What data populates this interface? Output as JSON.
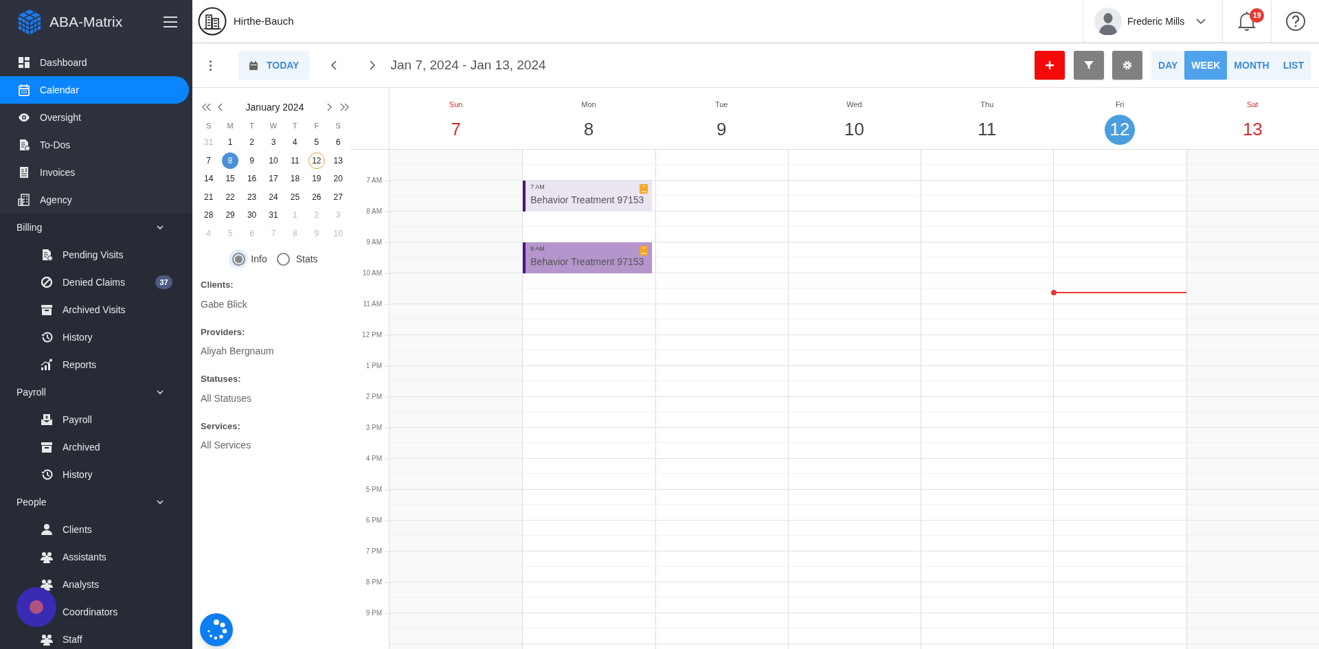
{
  "sidebar": {
    "brand": "ABA-Matrix",
    "items": [
      {
        "label": "Dashboard",
        "selected": false
      },
      {
        "label": "Calendar",
        "selected": true
      },
      {
        "label": "Oversight",
        "selected": false
      },
      {
        "label": "To-Dos",
        "selected": false
      },
      {
        "label": "Invoices",
        "selected": false
      },
      {
        "label": "Agency",
        "selected": false
      }
    ],
    "sections": [
      {
        "label": "Billing",
        "expanded": true,
        "items": [
          {
            "label": "Pending Visits",
            "selected": false
          },
          {
            "label": "Denied Claims",
            "selected": false,
            "badge": "37"
          },
          {
            "label": "Archived Visits",
            "selected": false
          },
          {
            "label": "History",
            "selected": false
          },
          {
            "label": "Reports",
            "selected": false
          }
        ]
      },
      {
        "label": "Payroll",
        "expanded": true,
        "items": [
          {
            "label": "Payroll",
            "selected": false
          },
          {
            "label": "Archived",
            "selected": false
          },
          {
            "label": "History",
            "selected": false
          }
        ]
      },
      {
        "label": "People",
        "expanded": true,
        "items": [
          {
            "label": "Clients",
            "selected": false
          },
          {
            "label": "Assistants",
            "selected": false
          },
          {
            "label": "Analysts",
            "selected": false
          },
          {
            "label": "Coordinators",
            "selected": false
          },
          {
            "label": "Staff",
            "selected": false
          }
        ]
      }
    ]
  },
  "header": {
    "company": "Hirthe-Bauch",
    "user": "Frederic Mills",
    "notifications": "19"
  },
  "toolbar": {
    "today": "TODAY",
    "range": "Jan 7, 2024 - Jan 13, 2024",
    "views": [
      {
        "label": "DAY",
        "selected": false
      },
      {
        "label": "WEEK",
        "selected": true
      },
      {
        "label": "MONTH",
        "selected": false
      },
      {
        "label": "LIST",
        "selected": false
      }
    ]
  },
  "mini_calendar": {
    "title": "January 2024",
    "weekdays": [
      "S",
      "M",
      "T",
      "W",
      "T",
      "F",
      "S"
    ],
    "weeks": [
      [
        {
          "label": "31",
          "muted": true,
          "selected": false,
          "today": false
        },
        {
          "label": "1",
          "muted": false,
          "selected": false,
          "today": false
        },
        {
          "label": "2",
          "muted": false,
          "selected": false,
          "today": false
        },
        {
          "label": "3",
          "muted": false,
          "selected": false,
          "today": false
        },
        {
          "label": "4",
          "muted": false,
          "selected": false,
          "today": false
        },
        {
          "label": "5",
          "muted": false,
          "selected": false,
          "today": false
        },
        {
          "label": "6",
          "muted": false,
          "selected": false,
          "today": false
        }
      ],
      [
        {
          "label": "7",
          "muted": false,
          "selected": false,
          "today": false
        },
        {
          "label": "8",
          "muted": false,
          "selected": true,
          "today": false
        },
        {
          "label": "9",
          "muted": false,
          "selected": false,
          "today": false
        },
        {
          "label": "10",
          "muted": false,
          "selected": false,
          "today": false
        },
        {
          "label": "11",
          "muted": false,
          "selected": false,
          "today": false
        },
        {
          "label": "12",
          "muted": false,
          "selected": false,
          "today": true
        },
        {
          "label": "13",
          "muted": false,
          "selected": false,
          "today": false
        }
      ],
      [
        {
          "label": "14",
          "muted": false,
          "selected": false,
          "today": false
        },
        {
          "label": "15",
          "muted": false,
          "selected": false,
          "today": false
        },
        {
          "label": "16",
          "muted": false,
          "selected": false,
          "today": false
        },
        {
          "label": "17",
          "muted": false,
          "selected": false,
          "today": false
        },
        {
          "label": "18",
          "muted": false,
          "selected": false,
          "today": false
        },
        {
          "label": "19",
          "muted": false,
          "selected": false,
          "today": false
        },
        {
          "label": "20",
          "muted": false,
          "selected": false,
          "today": false
        }
      ],
      [
        {
          "label": "21",
          "muted": false,
          "selected": false,
          "today": false
        },
        {
          "label": "22",
          "muted": false,
          "selected": false,
          "today": false
        },
        {
          "label": "23",
          "muted": false,
          "selected": false,
          "today": false
        },
        {
          "label": "24",
          "muted": false,
          "selected": false,
          "today": false
        },
        {
          "label": "25",
          "muted": false,
          "selected": false,
          "today": false
        },
        {
          "label": "26",
          "muted": false,
          "selected": false,
          "today": false
        },
        {
          "label": "27",
          "muted": false,
          "selected": false,
          "today": false
        }
      ],
      [
        {
          "label": "28",
          "muted": false,
          "selected": false,
          "today": false
        },
        {
          "label": "29",
          "muted": false,
          "selected": false,
          "today": false
        },
        {
          "label": "30",
          "muted": false,
          "selected": false,
          "today": false
        },
        {
          "label": "31",
          "muted": false,
          "selected": false,
          "today": false
        },
        {
          "label": "1",
          "muted": true,
          "selected": false,
          "today": false
        },
        {
          "label": "2",
          "muted": true,
          "selected": false,
          "today": false
        },
        {
          "label": "3",
          "muted": true,
          "selected": false,
          "today": false
        }
      ],
      [
        {
          "label": "4",
          "muted": true,
          "selected": false,
          "today": false
        },
        {
          "label": "5",
          "muted": true,
          "selected": false,
          "today": false
        },
        {
          "label": "6",
          "muted": true,
          "selected": false,
          "today": false
        },
        {
          "label": "7",
          "muted": true,
          "selected": false,
          "today": false
        },
        {
          "label": "8",
          "muted": true,
          "selected": false,
          "today": false
        },
        {
          "label": "9",
          "muted": true,
          "selected": false,
          "today": false
        },
        {
          "label": "10",
          "muted": true,
          "selected": false,
          "today": false
        }
      ]
    ]
  },
  "view_options": [
    {
      "label": "Info",
      "selected": true
    },
    {
      "label": "Stats",
      "selected": false
    }
  ],
  "filters": [
    {
      "label": "Clients:",
      "value": "Gabe Blick"
    },
    {
      "label": "Providers:",
      "value": "Aliyah Bergnaum"
    },
    {
      "label": "Statuses:",
      "value": "All Statuses"
    },
    {
      "label": "Services:",
      "value": "All Services"
    }
  ],
  "week": {
    "hours": [
      "7 AM",
      "8 AM",
      "9 AM",
      "10 AM",
      "11 AM",
      "12 PM",
      "1 PM",
      "2 PM",
      "3 PM",
      "4 PM",
      "5 PM",
      "6 PM",
      "7 PM",
      "8 PM",
      "9 PM"
    ],
    "days": [
      {
        "name": "Sun",
        "date": "7",
        "weekend": true,
        "today": false
      },
      {
        "name": "Mon",
        "date": "8",
        "weekend": false,
        "today": false,
        "events": [
          {
            "time": "7 AM",
            "title": "Behavior Treatment 97153",
            "color": "#ebe5f2"
          },
          {
            "time": "9 AM",
            "title": "Behavior Treatment 97153",
            "color": "#b595cc"
          }
        ]
      },
      {
        "name": "Tue",
        "date": "9",
        "weekend": false,
        "today": false
      },
      {
        "name": "Wed",
        "date": "10",
        "weekend": false,
        "today": false
      },
      {
        "name": "Thu",
        "date": "11",
        "weekend": false,
        "today": false
      },
      {
        "name": "Fri",
        "date": "12",
        "weekend": false,
        "today": true
      },
      {
        "name": "Sat",
        "date": "13",
        "weekend": true,
        "today": false
      }
    ]
  }
}
